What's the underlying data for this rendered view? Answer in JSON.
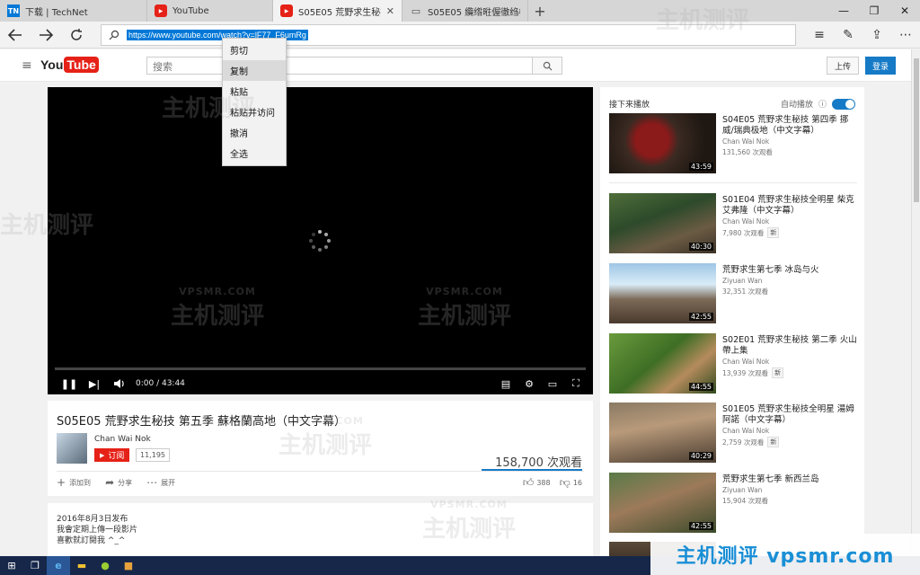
{
  "browser": {
    "tabs": [
      {
        "label": "下载 | TechNet",
        "fav": "TN"
      },
      {
        "label": "YouTube",
        "fav": "▶"
      },
      {
        "label": "S05E05 荒野求生秘技 第",
        "fav": "▶"
      },
      {
        "label": "S05E05 纜绺暀偓徹绉橀",
        "fav": "▭"
      }
    ],
    "url": "https://www.youtube.com/watch?v=lF77_F6umRg",
    "icons": {
      "back": "back-arrow-icon",
      "forward": "forward-arrow-icon",
      "refresh": "refresh-icon",
      "hub": "hub-icon",
      "note": "web-note-icon",
      "share": "share-icon",
      "more": "more-icon"
    }
  },
  "context_menu": {
    "items": [
      "剪切",
      "复制",
      "粘贴",
      "粘贴并访问",
      "撤消",
      "全选"
    ],
    "hover_index": 1
  },
  "youtube": {
    "logo_you": "You",
    "logo_tube": "Tube",
    "search_placeholder": "搜索",
    "upload_label": "上传",
    "login_label": "登录"
  },
  "player": {
    "time": "0:00 / 43:44",
    "loading": true
  },
  "video": {
    "title": "S05E05 荒野求生秘技 第五季 蘇格蘭高地（中文字幕）",
    "channel": "Chan Wai Nok",
    "subscribe_label": "订阅",
    "subscriber_count": "11,195",
    "views": "158,700 次观看",
    "add_label": "添加到",
    "share_label": "分享",
    "more_label": "展开",
    "likes": "388",
    "dislikes": "16"
  },
  "description": {
    "published": "2016年8月3日发布",
    "line1": "我會定期上傳一段影片",
    "line2": "喜歡就訂閱我 ^_^"
  },
  "sidebar": {
    "up_next_label": "接下来播放",
    "autoplay_label": "自动播放",
    "autoplay_on": true,
    "items": [
      {
        "title": "S04E05 荒野求生秘技 第四季 挪威/瑞典极地（中文字幕）",
        "channel": "Chan Wai Nok",
        "views": "131,560 次观看",
        "duration": "43:59",
        "new": false
      },
      {
        "title": "S01E04 荒野求生秘技全明星 柴克艾弗隆（中文字幕）",
        "channel": "Chan Wai Nok",
        "views": "7,980 次观看",
        "duration": "40:30",
        "new": true
      },
      {
        "title": "荒野求生第七季 冰岛与火",
        "channel": "Ziyuan Wan",
        "views": "32,351 次观看",
        "duration": "42:55",
        "new": false
      },
      {
        "title": "S02E01 荒野求生秘技 第二季 火山帶上集",
        "channel": "Chan Wai Nok",
        "views": "13,939 次观看",
        "duration": "44:55",
        "new": true
      },
      {
        "title": "S01E05 荒野求生秘技全明星 湯姆阿諾（中文字幕）",
        "channel": "Chan Wai Nok",
        "views": "2,759 次观看",
        "duration": "40:29",
        "new": true
      },
      {
        "title": "荒野求生第七季 新西兰岛",
        "channel": "Ziyuan Wan",
        "views": "15,904 次观看",
        "duration": "42:55",
        "new": false
      }
    ],
    "new_label": "新"
  },
  "watermark": {
    "brand": "主机测评",
    "domain": "VPSMR.COM",
    "banner": "主机测评  vpsmr.com"
  }
}
